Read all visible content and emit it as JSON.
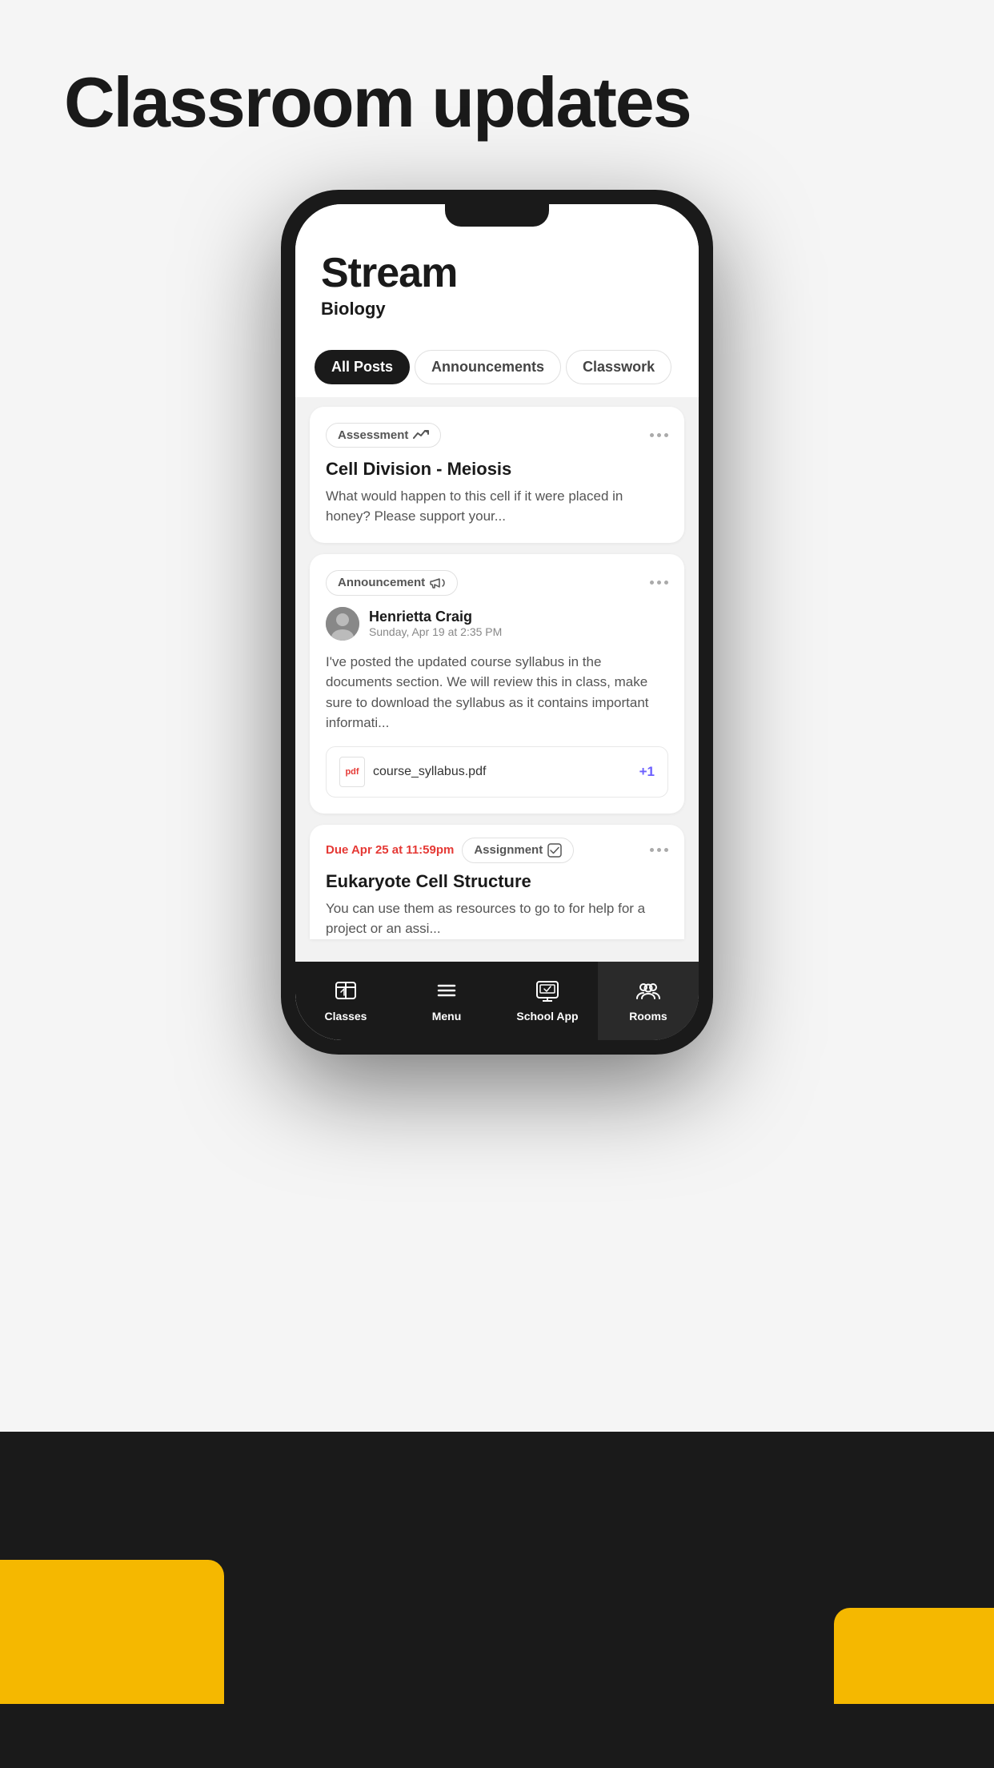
{
  "page": {
    "title": "Classroom updates",
    "background_color": "#f5f5f5"
  },
  "phone": {
    "screen": {
      "header": {
        "title": "Stream",
        "subtitle": "Biology"
      },
      "filter_tabs": [
        {
          "label": "All Posts",
          "active": true
        },
        {
          "label": "Announcements",
          "active": false
        },
        {
          "label": "Classwork",
          "active": false
        }
      ],
      "posts": [
        {
          "type": "assessment",
          "badge_label": "Assessment",
          "title": "Cell Division - Meiosis",
          "body": "What would happen to this cell if it were placed in honey? Please support your..."
        },
        {
          "type": "announcement",
          "badge_label": "Announcement",
          "author": "Henrietta Craig",
          "date": "Sunday, Apr 19 at 2:35 PM",
          "body": "I've posted the updated course syllabus in the documents section. We will review this in class, make sure to download the syllabus as it contains important informati...",
          "attachment": {
            "name": "course_syllabus.pdf",
            "extra": "+1"
          }
        },
        {
          "type": "assignment",
          "badge_label": "Assignment",
          "due_label": "Due Apr 25 at 11:59pm",
          "title": "Eukaryote Cell Structure",
          "body": "You can use them as resources to go to for help for a project or an assi..."
        }
      ],
      "bottom_nav": [
        {
          "label": "Classes",
          "icon": "classes-icon",
          "active": false
        },
        {
          "label": "Menu",
          "icon": "menu-icon",
          "active": false
        },
        {
          "label": "School App",
          "icon": "school-app-icon",
          "active": true
        },
        {
          "label": "Rooms",
          "icon": "rooms-icon",
          "active": true
        }
      ]
    }
  }
}
